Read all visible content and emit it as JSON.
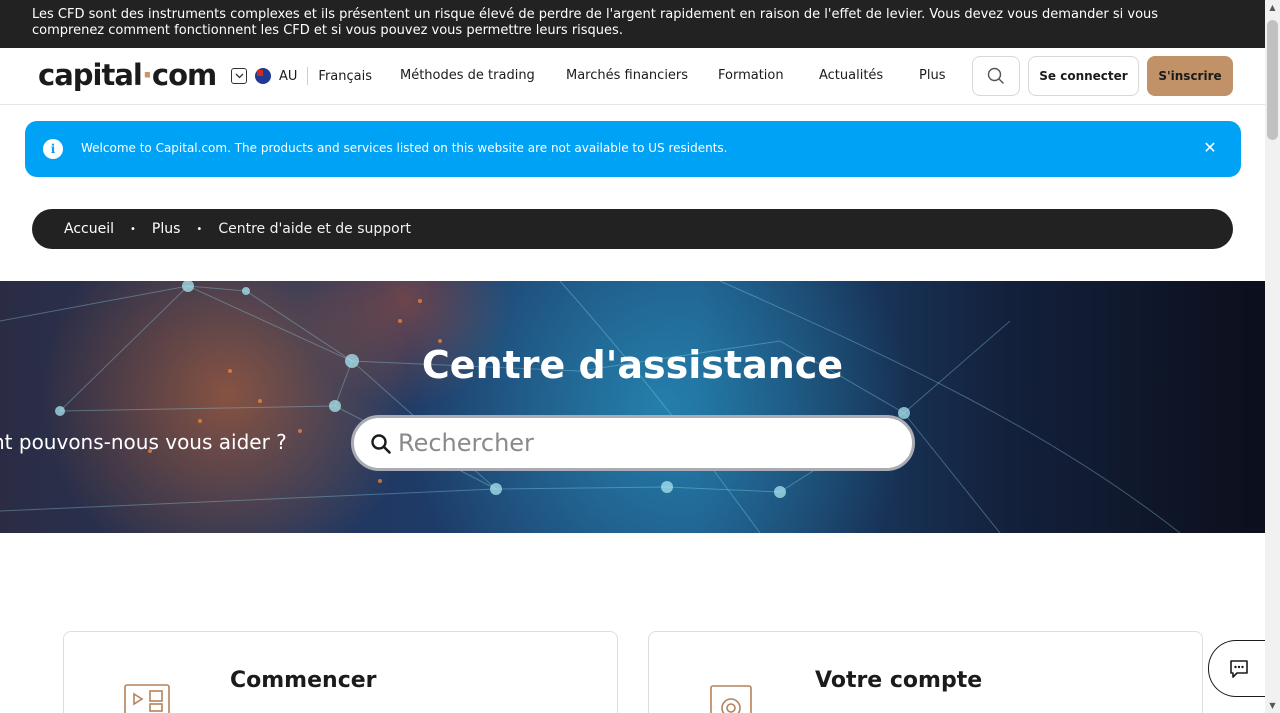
{
  "risk_warning": "Les CFD sont des instruments complexes et ils présentent un risque élevé de perdre de l'argent rapidement en raison de l'effet de levier. Vous devez vous demander si vous comprenez comment fonctionnent les CFD et si vous pouvez vous permettre leurs risques.",
  "header": {
    "logo_left": "capital",
    "logo_dot": "·",
    "logo_right": "com",
    "region": "AU",
    "language": "Français",
    "nav": [
      "Méthodes de trading",
      "Marchés financiers",
      "Formation",
      "Actualités",
      "Plus"
    ],
    "login_label": "Se connecter",
    "signup_label": "S'inscrire"
  },
  "banner": {
    "info_glyph": "i",
    "message": "Welcome to Capital.com. The products and services listed on this website are not available to US residents.",
    "close_glyph": "✕"
  },
  "breadcrumb": {
    "items": [
      "Accueil",
      "Plus",
      "Centre d'aide et de support"
    ],
    "separator": "•"
  },
  "hero": {
    "title": "Centre d'assistance",
    "question": "nt pouvons-nous vous aider ?",
    "search_placeholder": "Rechercher"
  },
  "cards": [
    {
      "title": "Commencer"
    },
    {
      "title": "Votre compte"
    }
  ],
  "colors": {
    "accent": "#c19268",
    "banner": "#00a2f5",
    "dark": "#222222"
  },
  "icons": {
    "search": "search-icon",
    "chat": "chat-icon",
    "close": "close-icon",
    "info": "info-icon"
  }
}
